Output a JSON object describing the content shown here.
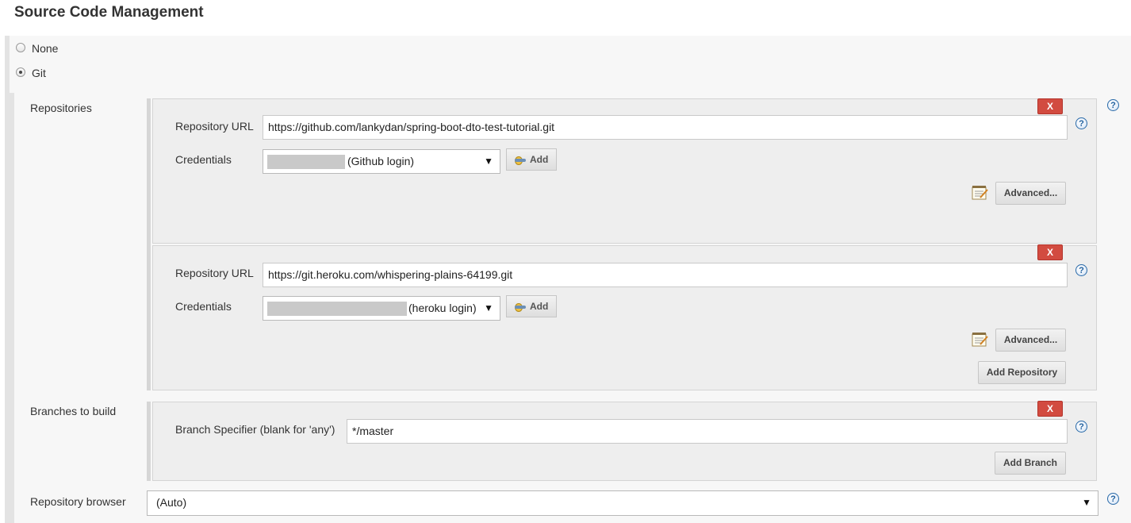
{
  "section": {
    "title": "Source Code Management"
  },
  "scm_options": [
    {
      "label": "None",
      "selected": false
    },
    {
      "label": "Git",
      "selected": true
    }
  ],
  "repositories": {
    "label": "Repositories",
    "items": [
      {
        "url_label": "Repository URL",
        "url": "https://github.com/lankydan/spring-boot-dto-test-tutorial.git",
        "credentials_label": "Credentials",
        "credentials_value": "(Github login)",
        "add_label": "Add",
        "advanced_label": "Advanced...",
        "delete_label": "X"
      },
      {
        "url_label": "Repository URL",
        "url": "https://git.heroku.com/whispering-plains-64199.git",
        "credentials_label": "Credentials",
        "credentials_value": "(heroku login)",
        "add_label": "Add",
        "advanced_label": "Advanced...",
        "delete_label": "X"
      }
    ],
    "add_repository_label": "Add Repository"
  },
  "branches": {
    "label": "Branches to build",
    "specifier_label": "Branch Specifier (blank for 'any')",
    "specifier_value": "*/master",
    "delete_label": "X",
    "add_branch_label": "Add Branch"
  },
  "repository_browser": {
    "label": "Repository browser",
    "value": "(Auto)"
  },
  "help_glyph": "?",
  "select_arrow_glyph": "▼",
  "colors": {
    "delete_button": "#d24b40",
    "help_icon": "#2a6aa8",
    "block_background": "#eeeeee"
  }
}
